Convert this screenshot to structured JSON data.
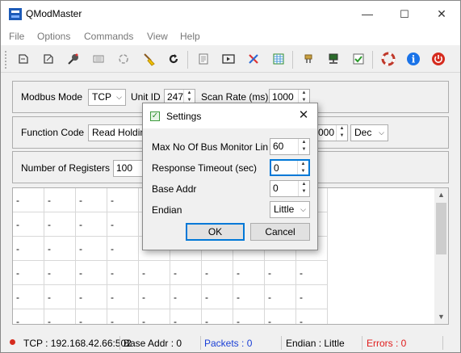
{
  "window": {
    "title": "QModMaster",
    "minimize": "—",
    "maximize": "☐",
    "close": "✕"
  },
  "menu": [
    "File",
    "Options",
    "Commands",
    "View",
    "Help"
  ],
  "toolbar": {
    "icons": [
      "connect-icon",
      "disconnect-icon",
      "read-write-icon",
      "scan-icon",
      "reset-icon",
      "clear-icon",
      "refresh-icon",
      "log-icon",
      "bus-monitor-icon",
      "tools-icon",
      "table-icon",
      "modbus-rtu-icon",
      "modbus-tcp-icon",
      "settings-icon",
      "help-icon",
      "about-icon",
      "exit-icon"
    ],
    "colors": {
      "about": "#1a73e8",
      "exit": "#d52b1e",
      "help": "#c0392b"
    }
  },
  "modbus_group": {
    "mode_label": "Modbus Mode",
    "mode_value": "TCP",
    "unit_id_label": "Unit ID",
    "unit_id_value": "247",
    "scan_rate_label": "Scan Rate (ms)",
    "scan_rate_value": "1000"
  },
  "function_group": {
    "function_code_label": "Function Code",
    "function_code_value": "Read Holding",
    "start_value_partial": "000",
    "format_value": "Dec"
  },
  "registers_group": {
    "num_registers_label": "Number of Registers",
    "num_registers_value": "100"
  },
  "grid": {
    "cell_placeholder": "-"
  },
  "status": {
    "connection": "TCP : 192.168.42.66:502",
    "base_addr": "Base Addr : 0",
    "packets": "Packets : 0",
    "endian": "Endian : Little",
    "errors": "Errors : 0",
    "packets_color": "#1a3fd6",
    "errors_color": "#e01b1b"
  },
  "settings_dialog": {
    "title": "Settings",
    "max_bus_monitor_label": "Max No Of Bus Monitor Lin",
    "max_bus_monitor_value": "60",
    "response_timeout_label": "Response Timeout (sec)",
    "response_timeout_value": "0",
    "base_addr_label": "Base Addr",
    "base_addr_value": "0",
    "endian_label": "Endian",
    "endian_value": "Little",
    "ok_label": "OK",
    "cancel_label": "Cancel"
  }
}
